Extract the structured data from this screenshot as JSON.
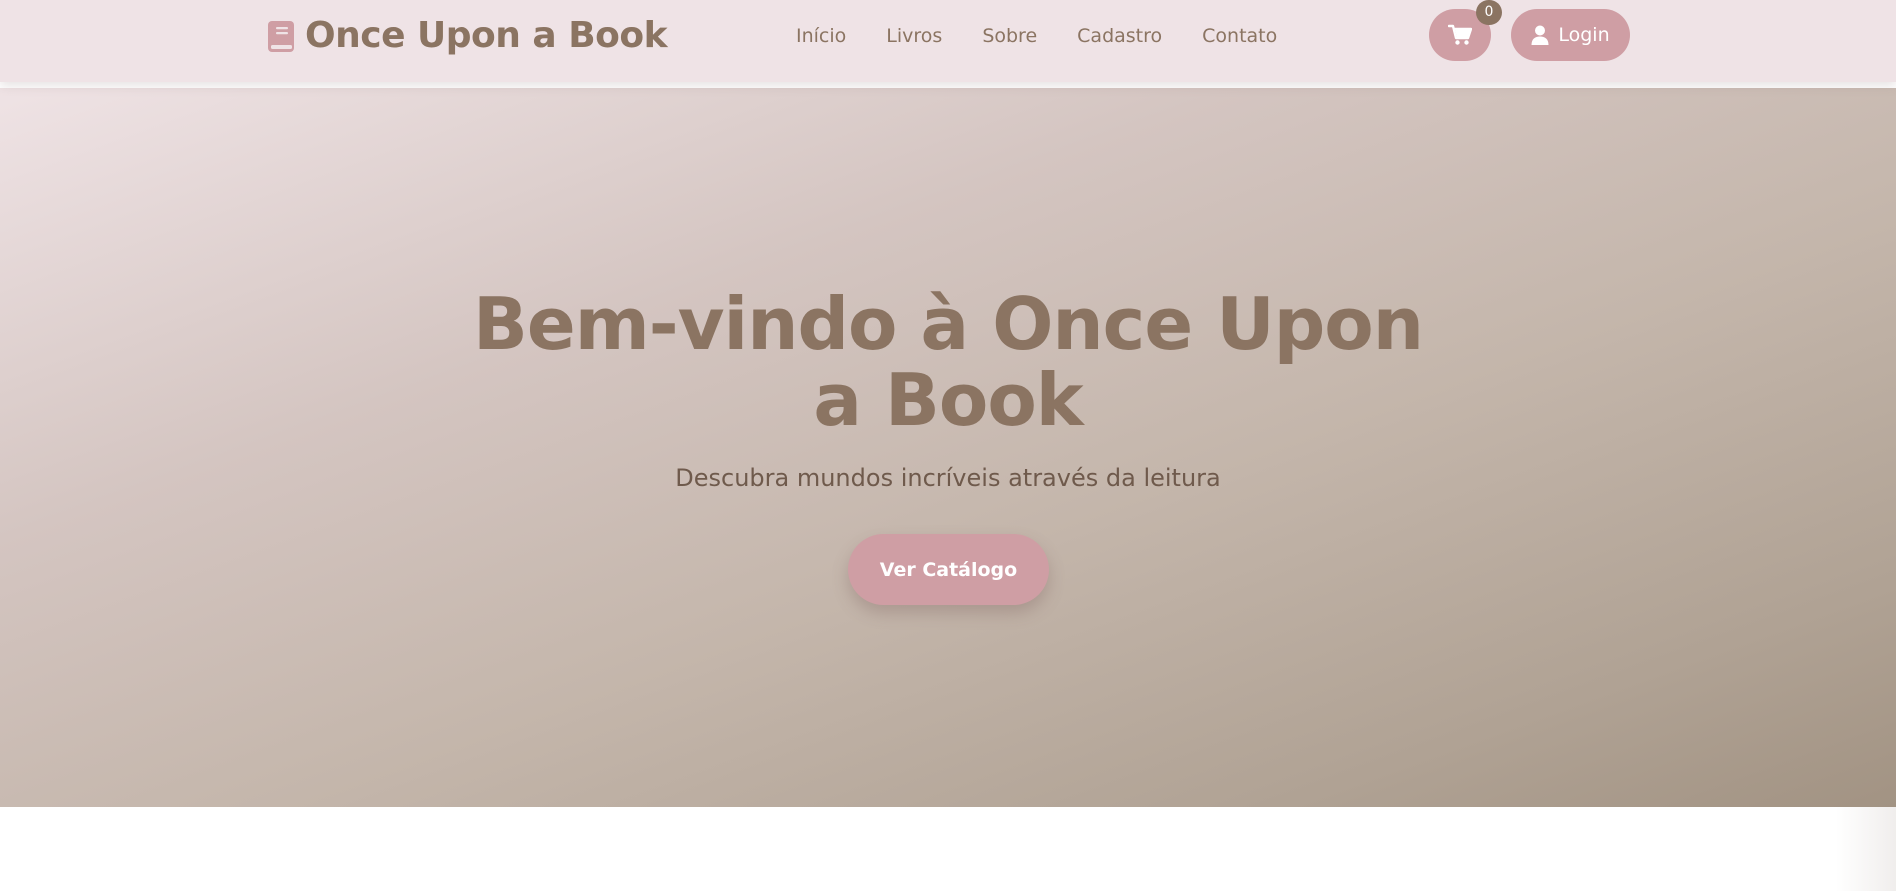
{
  "header": {
    "brand_name": "Once Upon a Book",
    "brand_icon": "book-icon",
    "nav": [
      {
        "label": "Início"
      },
      {
        "label": "Livros"
      },
      {
        "label": "Sobre"
      },
      {
        "label": "Cadastro"
      },
      {
        "label": "Contato"
      }
    ],
    "cart": {
      "icon": "cart-icon",
      "count": "0"
    },
    "login": {
      "icon": "user-icon",
      "label": "Login"
    }
  },
  "hero": {
    "title": "Bem-vindo à Once Upon a Book",
    "subtitle": "Descubra mundos incríveis através da leitura",
    "cta_label": "Ver Catálogo"
  },
  "colors": {
    "brand_brown": "#8b7462",
    "accent_pink": "#cf9ea4",
    "navbar_bg": "#efe3e6"
  }
}
